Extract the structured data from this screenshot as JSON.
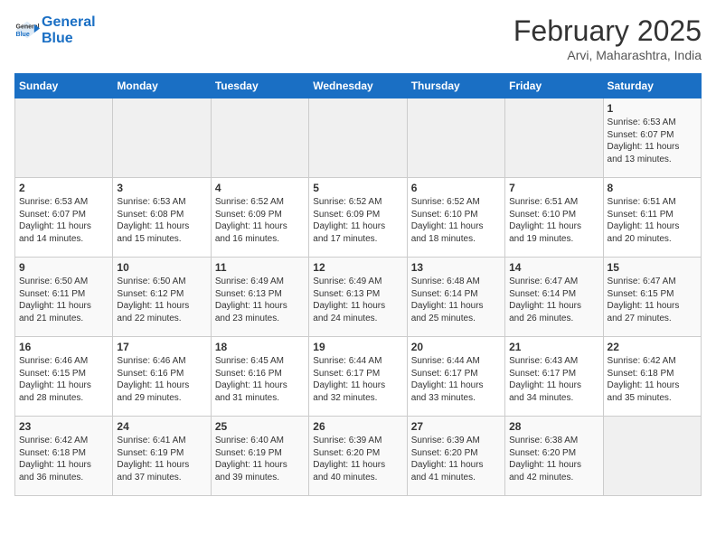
{
  "header": {
    "logo_line1": "General",
    "logo_line2": "Blue",
    "month_title": "February 2025",
    "subtitle": "Arvi, Maharashtra, India"
  },
  "weekdays": [
    "Sunday",
    "Monday",
    "Tuesday",
    "Wednesday",
    "Thursday",
    "Friday",
    "Saturday"
  ],
  "weeks": [
    [
      {
        "day": "",
        "detail": ""
      },
      {
        "day": "",
        "detail": ""
      },
      {
        "day": "",
        "detail": ""
      },
      {
        "day": "",
        "detail": ""
      },
      {
        "day": "",
        "detail": ""
      },
      {
        "day": "",
        "detail": ""
      },
      {
        "day": "1",
        "detail": "Sunrise: 6:53 AM\nSunset: 6:07 PM\nDaylight: 11 hours\nand 13 minutes."
      }
    ],
    [
      {
        "day": "2",
        "detail": "Sunrise: 6:53 AM\nSunset: 6:07 PM\nDaylight: 11 hours\nand 14 minutes."
      },
      {
        "day": "3",
        "detail": "Sunrise: 6:53 AM\nSunset: 6:08 PM\nDaylight: 11 hours\nand 15 minutes."
      },
      {
        "day": "4",
        "detail": "Sunrise: 6:52 AM\nSunset: 6:09 PM\nDaylight: 11 hours\nand 16 minutes."
      },
      {
        "day": "5",
        "detail": "Sunrise: 6:52 AM\nSunset: 6:09 PM\nDaylight: 11 hours\nand 17 minutes."
      },
      {
        "day": "6",
        "detail": "Sunrise: 6:52 AM\nSunset: 6:10 PM\nDaylight: 11 hours\nand 18 minutes."
      },
      {
        "day": "7",
        "detail": "Sunrise: 6:51 AM\nSunset: 6:10 PM\nDaylight: 11 hours\nand 19 minutes."
      },
      {
        "day": "8",
        "detail": "Sunrise: 6:51 AM\nSunset: 6:11 PM\nDaylight: 11 hours\nand 20 minutes."
      }
    ],
    [
      {
        "day": "9",
        "detail": "Sunrise: 6:50 AM\nSunset: 6:11 PM\nDaylight: 11 hours\nand 21 minutes."
      },
      {
        "day": "10",
        "detail": "Sunrise: 6:50 AM\nSunset: 6:12 PM\nDaylight: 11 hours\nand 22 minutes."
      },
      {
        "day": "11",
        "detail": "Sunrise: 6:49 AM\nSunset: 6:13 PM\nDaylight: 11 hours\nand 23 minutes."
      },
      {
        "day": "12",
        "detail": "Sunrise: 6:49 AM\nSunset: 6:13 PM\nDaylight: 11 hours\nand 24 minutes."
      },
      {
        "day": "13",
        "detail": "Sunrise: 6:48 AM\nSunset: 6:14 PM\nDaylight: 11 hours\nand 25 minutes."
      },
      {
        "day": "14",
        "detail": "Sunrise: 6:47 AM\nSunset: 6:14 PM\nDaylight: 11 hours\nand 26 minutes."
      },
      {
        "day": "15",
        "detail": "Sunrise: 6:47 AM\nSunset: 6:15 PM\nDaylight: 11 hours\nand 27 minutes."
      }
    ],
    [
      {
        "day": "16",
        "detail": "Sunrise: 6:46 AM\nSunset: 6:15 PM\nDaylight: 11 hours\nand 28 minutes."
      },
      {
        "day": "17",
        "detail": "Sunrise: 6:46 AM\nSunset: 6:16 PM\nDaylight: 11 hours\nand 29 minutes."
      },
      {
        "day": "18",
        "detail": "Sunrise: 6:45 AM\nSunset: 6:16 PM\nDaylight: 11 hours\nand 31 minutes."
      },
      {
        "day": "19",
        "detail": "Sunrise: 6:44 AM\nSunset: 6:17 PM\nDaylight: 11 hours\nand 32 minutes."
      },
      {
        "day": "20",
        "detail": "Sunrise: 6:44 AM\nSunset: 6:17 PM\nDaylight: 11 hours\nand 33 minutes."
      },
      {
        "day": "21",
        "detail": "Sunrise: 6:43 AM\nSunset: 6:17 PM\nDaylight: 11 hours\nand 34 minutes."
      },
      {
        "day": "22",
        "detail": "Sunrise: 6:42 AM\nSunset: 6:18 PM\nDaylight: 11 hours\nand 35 minutes."
      }
    ],
    [
      {
        "day": "23",
        "detail": "Sunrise: 6:42 AM\nSunset: 6:18 PM\nDaylight: 11 hours\nand 36 minutes."
      },
      {
        "day": "24",
        "detail": "Sunrise: 6:41 AM\nSunset: 6:19 PM\nDaylight: 11 hours\nand 37 minutes."
      },
      {
        "day": "25",
        "detail": "Sunrise: 6:40 AM\nSunset: 6:19 PM\nDaylight: 11 hours\nand 39 minutes."
      },
      {
        "day": "26",
        "detail": "Sunrise: 6:39 AM\nSunset: 6:20 PM\nDaylight: 11 hours\nand 40 minutes."
      },
      {
        "day": "27",
        "detail": "Sunrise: 6:39 AM\nSunset: 6:20 PM\nDaylight: 11 hours\nand 41 minutes."
      },
      {
        "day": "28",
        "detail": "Sunrise: 6:38 AM\nSunset: 6:20 PM\nDaylight: 11 hours\nand 42 minutes."
      },
      {
        "day": "",
        "detail": ""
      }
    ]
  ]
}
